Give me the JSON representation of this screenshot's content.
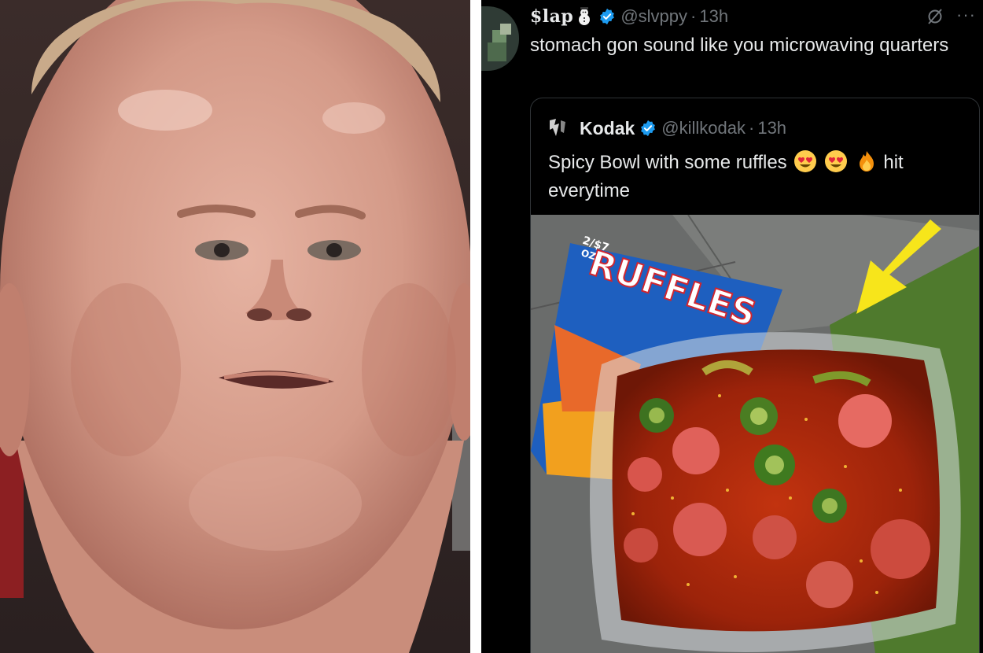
{
  "tweet": {
    "display_name": "$lap",
    "handle": "@slvppy",
    "separator": "·",
    "time": "13h",
    "text": "stomach gon sound like you microwaving quarters",
    "name_emoji": "snowman-icon",
    "verified_icon": "verified-badge-icon",
    "grok_icon": "grok-icon",
    "more_icon": "more-icon"
  },
  "quote": {
    "display_name": "Kodak",
    "handle": "@killkodak",
    "separator": "·",
    "time": "13h",
    "text_before": "Spicy Bowl with some ruffles",
    "emojis": [
      "heart-eyes-emoji",
      "heart-eyes-emoji",
      "fire-emoji"
    ],
    "text_after": "hit everytime",
    "media": {
      "chip_bag_brand": "RUFFLES",
      "chip_bag_small_text": "2/$7",
      "chip_bag_small_text2": "OZ.",
      "arrow_color": "#f7e51b"
    }
  },
  "colors": {
    "background": "#000000",
    "text_primary": "#e7e9ea",
    "text_secondary": "#71767b",
    "verified_blue": "#1d9bf0",
    "card_border": "#2f3336"
  }
}
